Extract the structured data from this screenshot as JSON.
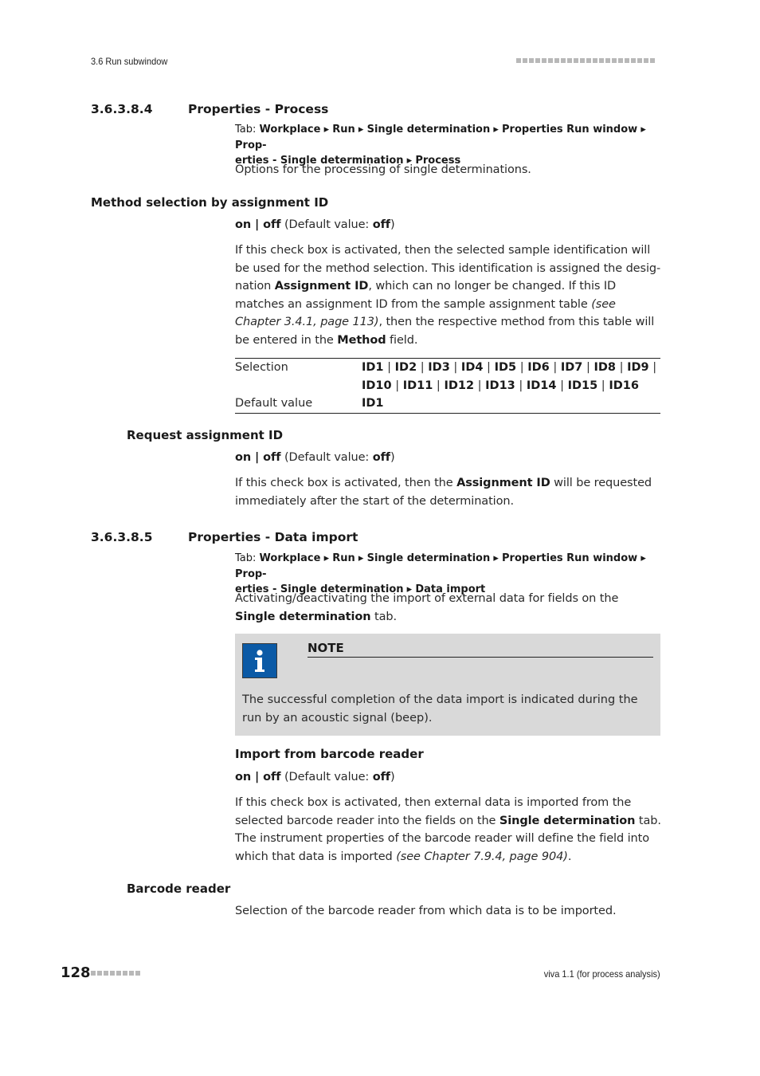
{
  "header": {
    "section_label": "3.6 Run subwindow"
  },
  "sections": {
    "process": {
      "number": "3.6.3.8.4",
      "title": "Properties - Process",
      "tab_prefix": "Tab: ",
      "tab_path_line1": [
        "Workplace",
        "Run",
        "Single determination",
        "Properties Run window",
        "Prop-"
      ],
      "tab_path_line2": [
        "erties - Single determination",
        "Process"
      ],
      "intro": "Options for the processing of single determinations."
    },
    "data_import": {
      "number": "3.6.3.8.5",
      "title": "Properties - Data import",
      "tab_prefix": "Tab: ",
      "tab_path_line1": [
        "Workplace",
        "Run",
        "Single determination",
        "Properties Run window",
        "Prop-"
      ],
      "tab_path_line2": [
        "erties - Single determination",
        "Data import"
      ],
      "intro_pre": "Activating/deactivating the import of external data for fields on the ",
      "intro_bold": "Single determination",
      "intro_post": " tab."
    }
  },
  "params": {
    "method_selection": {
      "title": "Method selection by assignment ID",
      "onoff": "on | off",
      "default_pre": " (Default value: ",
      "default_val": "off",
      "default_post": ")",
      "desc_1": "If this check box is activated, then the selected sample identification will be used for the method selection. This identification is assigned the desig-nation ",
      "desc_bold_1": "Assignment ID",
      "desc_2": ", which can no longer be changed. If this ID matches an assignment ID from the sample assignment table ",
      "desc_italic": "(see Chapter 3.4.1, page 113)",
      "desc_3": ", then the respective method from this table will be entered in the ",
      "desc_bold_2": "Method",
      "desc_4": " field.",
      "table": {
        "selection_label": "Selection",
        "selection_options": [
          "ID1",
          "ID2",
          "ID3",
          "ID4",
          "ID5",
          "ID6",
          "ID7",
          "ID8",
          "ID9",
          "ID10",
          "ID11",
          "ID12",
          "ID13",
          "ID14",
          "ID15",
          "ID16"
        ],
        "default_label": "Default value",
        "default_value": "ID1"
      }
    },
    "request_assignment": {
      "title": "Request assignment ID",
      "onoff": "on | off",
      "default_pre": " (Default value: ",
      "default_val": "off",
      "default_post": ")",
      "desc_1": "If this check box is activated, then the ",
      "desc_bold": "Assignment ID",
      "desc_2": " will be requested immediately after the start of the determination."
    },
    "import_barcode": {
      "title": "Import from barcode reader",
      "onoff": "on | off",
      "default_pre": " (Default value: ",
      "default_val": "off",
      "default_post": ")",
      "desc_1": "If this check box is activated, then external data is imported from the selected barcode reader into the fields on the ",
      "desc_bold": "Single determination",
      "desc_2": " tab. The instrument properties of the barcode reader will define the field into which that data is imported ",
      "desc_italic": "(see Chapter 7.9.4, page 904)",
      "desc_3": "."
    },
    "barcode_reader": {
      "title": "Barcode reader",
      "desc": "Selection of the barcode reader from which data is to be imported."
    }
  },
  "note": {
    "icon": "info-icon",
    "title": "NOTE",
    "text": "The successful completion of the data import is indicated during the run by an acoustic signal (beep)."
  },
  "footer": {
    "page_number": "128",
    "product": "viva 1.1 (for process analysis)"
  },
  "colors": {
    "note_bg": "#d9d9d9",
    "note_icon": "#0b5aa6",
    "dots": "#b8b8b8"
  }
}
